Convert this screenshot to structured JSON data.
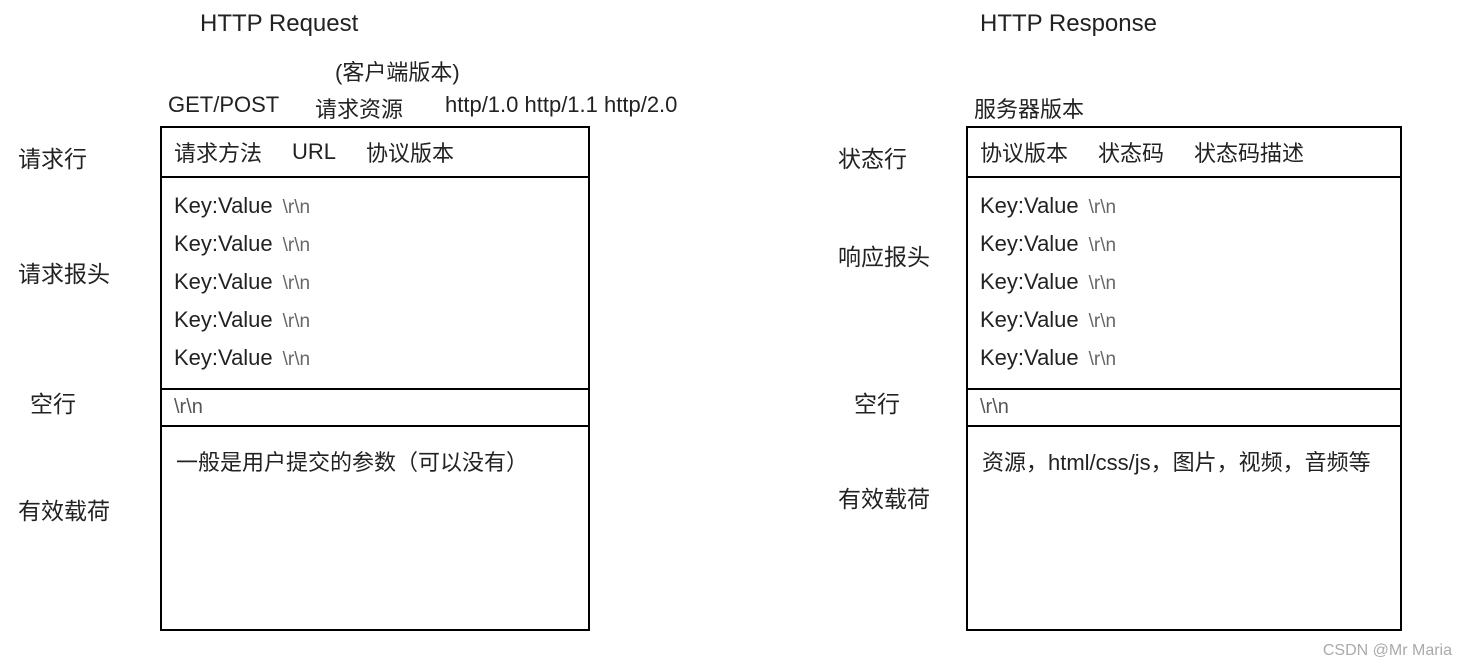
{
  "request": {
    "title": "HTTP Request",
    "top_annot": {
      "method": "GET/POST",
      "resource": "请求资源",
      "client_version_label": "(客户端版本)",
      "versions": "http/1.0  http/1.1  http/2.0"
    },
    "status_line": {
      "c1": "请求方法",
      "c2": "URL",
      "c3": "协议版本"
    },
    "headers": [
      {
        "kv": "Key:Value",
        "crlf": "\\r\\n"
      },
      {
        "kv": "Key:Value",
        "crlf": "\\r\\n"
      },
      {
        "kv": "Key:Value",
        "crlf": "\\r\\n"
      },
      {
        "kv": "Key:Value",
        "crlf": "\\r\\n"
      },
      {
        "kv": "Key:Value",
        "crlf": "\\r\\n"
      }
    ],
    "empty_line": "\\r\\n",
    "payload": "一般是用户提交的参数（可以没有）",
    "labels": {
      "line": "请求行",
      "headers": "请求报头",
      "empty": "空行",
      "payload": "有效载荷"
    }
  },
  "response": {
    "title": "HTTP Response",
    "top_annot": {
      "server_version": "服务器版本"
    },
    "status_line": {
      "c1": "协议版本",
      "c2": "状态码",
      "c3": "状态码描述"
    },
    "headers": [
      {
        "kv": "Key:Value",
        "crlf": "\\r\\n"
      },
      {
        "kv": "Key:Value",
        "crlf": "\\r\\n"
      },
      {
        "kv": "Key:Value",
        "crlf": "\\r\\n"
      },
      {
        "kv": "Key:Value",
        "crlf": "\\r\\n"
      },
      {
        "kv": "Key:Value",
        "crlf": "\\r\\n"
      }
    ],
    "empty_line": "\\r\\n",
    "payload": "资源，html/css/js，图片，视频，音频等",
    "labels": {
      "line": "状态行",
      "headers": "响应报头",
      "empty": "空行",
      "payload": "有效载荷"
    }
  },
  "attribution": "CSDN @Mr Maria"
}
